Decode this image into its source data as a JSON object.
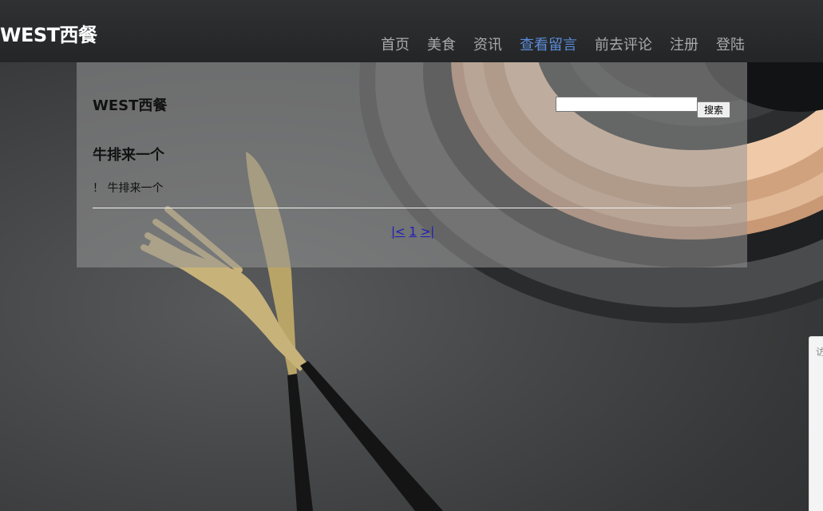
{
  "navbar": {
    "brand": "WEST西餐",
    "items": [
      {
        "label": "首页"
      },
      {
        "label": "美食"
      },
      {
        "label": "资讯"
      },
      {
        "label": "查看留言"
      },
      {
        "label": "前去评论"
      },
      {
        "label": "注册"
      },
      {
        "label": "登陆"
      }
    ],
    "active_index": 3,
    "active_color": "#5b8bd6"
  },
  "panel": {
    "site_title": "WEST西餐",
    "search": {
      "value": "",
      "button_label": "搜索"
    },
    "post": {
      "title": "牛排来一个",
      "body": "！ 牛排来一个"
    },
    "pager": {
      "first": "|<",
      "page": "1",
      "last": ">|"
    }
  },
  "edge_widget": {
    "text": "访"
  }
}
